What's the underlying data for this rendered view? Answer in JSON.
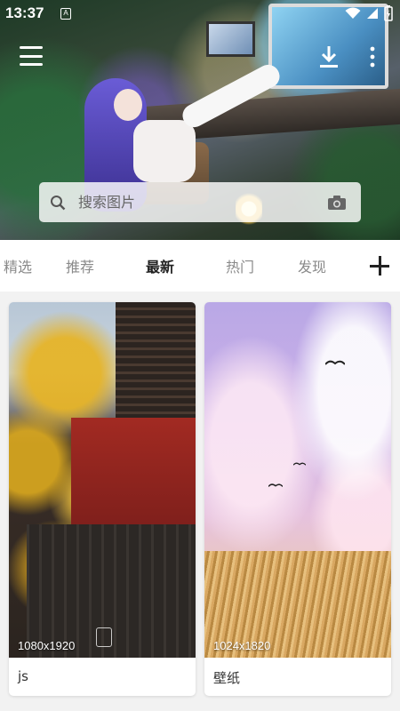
{
  "status_bar": {
    "time": "13:37",
    "notification_icon": "A"
  },
  "header": {
    "menu_icon": "hamburger-menu-icon",
    "download_icon": "download-icon",
    "more_icon": "more-vertical-icon"
  },
  "search": {
    "placeholder": "搜索图片",
    "icon": "search-icon",
    "camera_icon": "camera-icon"
  },
  "tabs": [
    {
      "label": "精选",
      "active": false
    },
    {
      "label": "推荐",
      "active": false
    },
    {
      "label": "最新",
      "active": true
    },
    {
      "label": "热门",
      "active": false
    },
    {
      "label": "发现",
      "active": false
    }
  ],
  "add_tab_icon": "plus-icon",
  "wallpapers": [
    {
      "resolution": "1080x1920",
      "caption": "js"
    },
    {
      "resolution": "1024x1820",
      "caption": "壁纸"
    }
  ],
  "colors": {
    "active_tab": "#222222",
    "inactive_tab": "#8a8a8a",
    "background": "#f2f2f2"
  }
}
